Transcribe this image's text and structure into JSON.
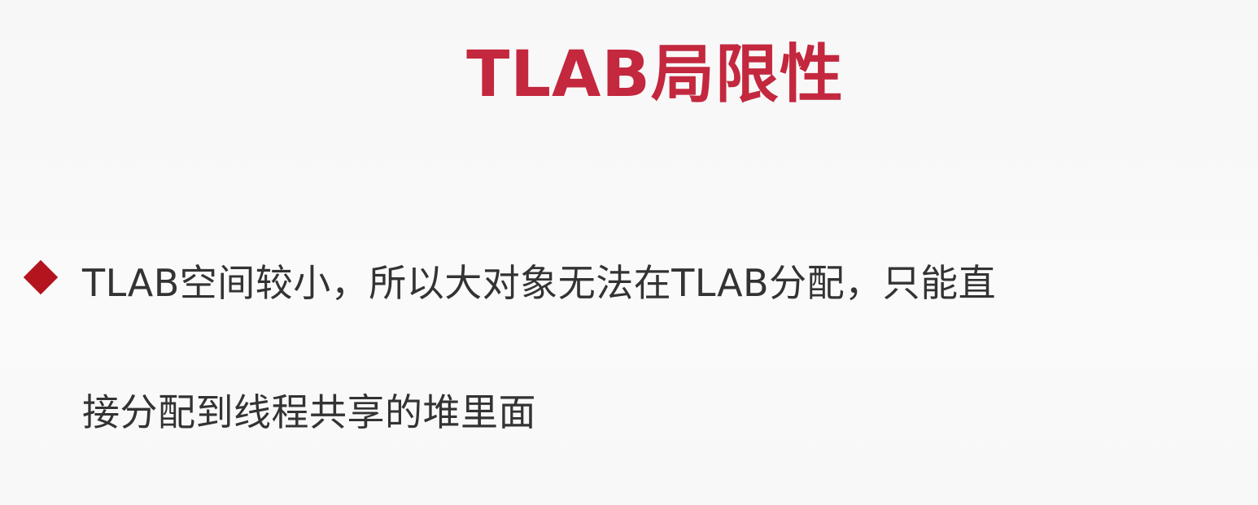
{
  "title": "TLAB局限性",
  "bullets": [
    {
      "line1": "TLAB空间较小，所以大对象无法在TLAB分配，只能直",
      "line2": "接分配到线程共享的堆里面"
    }
  ],
  "colors": {
    "title": "#c3283e",
    "bullet_marker": "#b3141e",
    "body_text": "#333333",
    "background": "#fafafa"
  },
  "icons": {
    "bullet_marker": "diamond-bullet-icon"
  }
}
